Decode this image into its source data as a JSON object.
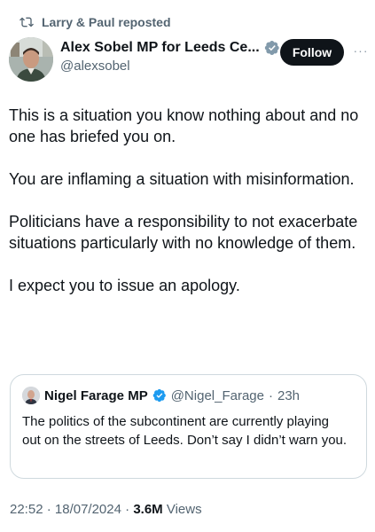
{
  "repost": {
    "text": "Larry & Paul reposted",
    "icon": "repost-icon"
  },
  "author": {
    "name": "Alex Sobel MP for Leeds Ce...",
    "handle": "@alexsobel",
    "verified_color": "#829aab",
    "avatar": "avatar-photo"
  },
  "actions": {
    "follow_label": "Follow",
    "more_label": "···"
  },
  "tweet": {
    "paragraphs": [
      "This is a situation you know nothing about and no one has briefed you on.",
      "You are inflaming a situation with misinformation.",
      "Politicians have a responsibility to not exacerbate situations particularly with no knowledge of them.",
      "I expect you to issue an apology."
    ]
  },
  "quote": {
    "name": "Nigel Farage MP",
    "handle": "@Nigel_Farage",
    "separator": "·",
    "time": "23h",
    "text": "The politics of the subcontinent are currently playing out on the streets of Leeds. Don’t say I didn’t warn you.",
    "verified_color": "#1d9bf0"
  },
  "meta": {
    "time": "22:52",
    "sep1": " · ",
    "date": "18/07/2024",
    "sep2": " · ",
    "views_count": "3.6M",
    "views_label": " Views"
  },
  "colors": {
    "text": "#0f1419",
    "secondary": "#536471",
    "border": "#cfd9de",
    "button": "#0f1419"
  }
}
